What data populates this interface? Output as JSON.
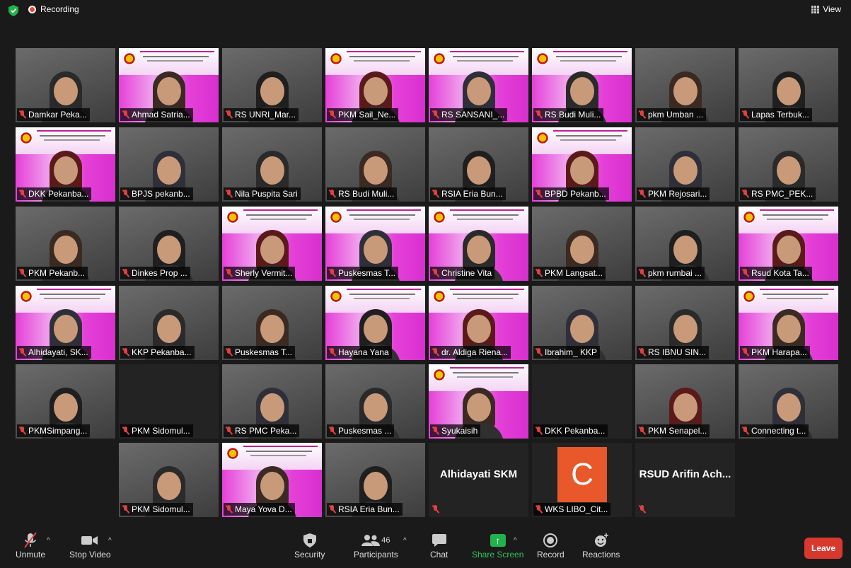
{
  "topbar": {
    "recording": "Recording",
    "view": "View"
  },
  "tiles": [
    {
      "name": "Damkar Peka...",
      "kind": "vid"
    },
    {
      "name": "Ahmad Satria...",
      "kind": "slide"
    },
    {
      "name": "RS UNRI_Mar...",
      "kind": "vid"
    },
    {
      "name": "PKM Sail_Ne...",
      "kind": "slide"
    },
    {
      "name": "RS SANSANI_...",
      "kind": "slide"
    },
    {
      "name": "RS Budi Muli...",
      "kind": "slide"
    },
    {
      "name": "pkm Umban ...",
      "kind": "vid"
    },
    {
      "name": "Lapas Terbuk...",
      "kind": "vid"
    },
    {
      "name": "DKK Pekanba...",
      "kind": "slide"
    },
    {
      "name": "BPJS pekanb...",
      "kind": "vid"
    },
    {
      "name": "Nila Puspita Sari",
      "kind": "vid"
    },
    {
      "name": "RS Budi Muli...",
      "kind": "vid"
    },
    {
      "name": "RSIA Eria Bun...",
      "kind": "vid"
    },
    {
      "name": "BPBD Pekanb...",
      "kind": "slide"
    },
    {
      "name": "PKM Rejosari...",
      "kind": "vid"
    },
    {
      "name": "RS PMC_PEK...",
      "kind": "vid"
    },
    {
      "name": "PKM Pekanb...",
      "kind": "vid"
    },
    {
      "name": "Dinkes Prop ...",
      "kind": "vid"
    },
    {
      "name": "Sherly Vermit...",
      "kind": "slide"
    },
    {
      "name": "Puskesmas T...",
      "kind": "slide"
    },
    {
      "name": "Christine Vita",
      "kind": "slide"
    },
    {
      "name": "PKM Langsat...",
      "kind": "vid"
    },
    {
      "name": "pkm rumbai ...",
      "kind": "vid"
    },
    {
      "name": "Rsud Kota Ta...",
      "kind": "slide"
    },
    {
      "name": "Alhidayati, SK...",
      "kind": "slide"
    },
    {
      "name": "KKP Pekanba...",
      "kind": "vid"
    },
    {
      "name": "Puskesmas T...",
      "kind": "vid"
    },
    {
      "name": "Hayana Yana",
      "kind": "slide"
    },
    {
      "name": "dr. Aldiga Riena...",
      "kind": "slide"
    },
    {
      "name": "Ibrahim_ KKP",
      "kind": "vid"
    },
    {
      "name": "RS IBNU SIN...",
      "kind": "vid"
    },
    {
      "name": "PKM Harapa...",
      "kind": "slide"
    },
    {
      "name": "PKMSimpang...",
      "kind": "vid"
    },
    {
      "name": "PKM Sidomul...",
      "kind": "blank"
    },
    {
      "name": "RS PMC Peka...",
      "kind": "vid"
    },
    {
      "name": "Puskesmas ...",
      "kind": "vid"
    },
    {
      "name": "Syukaisih",
      "kind": "slide"
    },
    {
      "name": "DKK Pekanba...",
      "kind": "blank"
    },
    {
      "name": "PKM Senapel...",
      "kind": "vid"
    },
    {
      "name": "Connecting t...",
      "kind": "vid"
    },
    {
      "name": "PKM Sidomul...",
      "kind": "vid"
    },
    {
      "name": "Maya Yova D...",
      "kind": "slide"
    },
    {
      "name": "RSIA Eria Bun...",
      "kind": "vid"
    },
    {
      "name": "",
      "kind": "text",
      "label": "Alhidayati SKM"
    },
    {
      "name": "WKS LIBO_Cit...",
      "kind": "avatar",
      "label": "C"
    },
    {
      "name": "",
      "kind": "text",
      "label": "RSUD Arifin Ach..."
    }
  ],
  "toolbar": {
    "unmute": "Unmute",
    "stop_video": "Stop Video",
    "security": "Security",
    "participants": "Participants",
    "participants_count": "46",
    "chat": "Chat",
    "share_screen": "Share Screen",
    "record": "Record",
    "reactions": "Reactions",
    "leave": "Leave"
  },
  "colors": {
    "accent_green": "#23b14d",
    "leave_red": "#d9382f",
    "recording_red": "#e8473c",
    "active_speaker": "#e8d44a"
  }
}
